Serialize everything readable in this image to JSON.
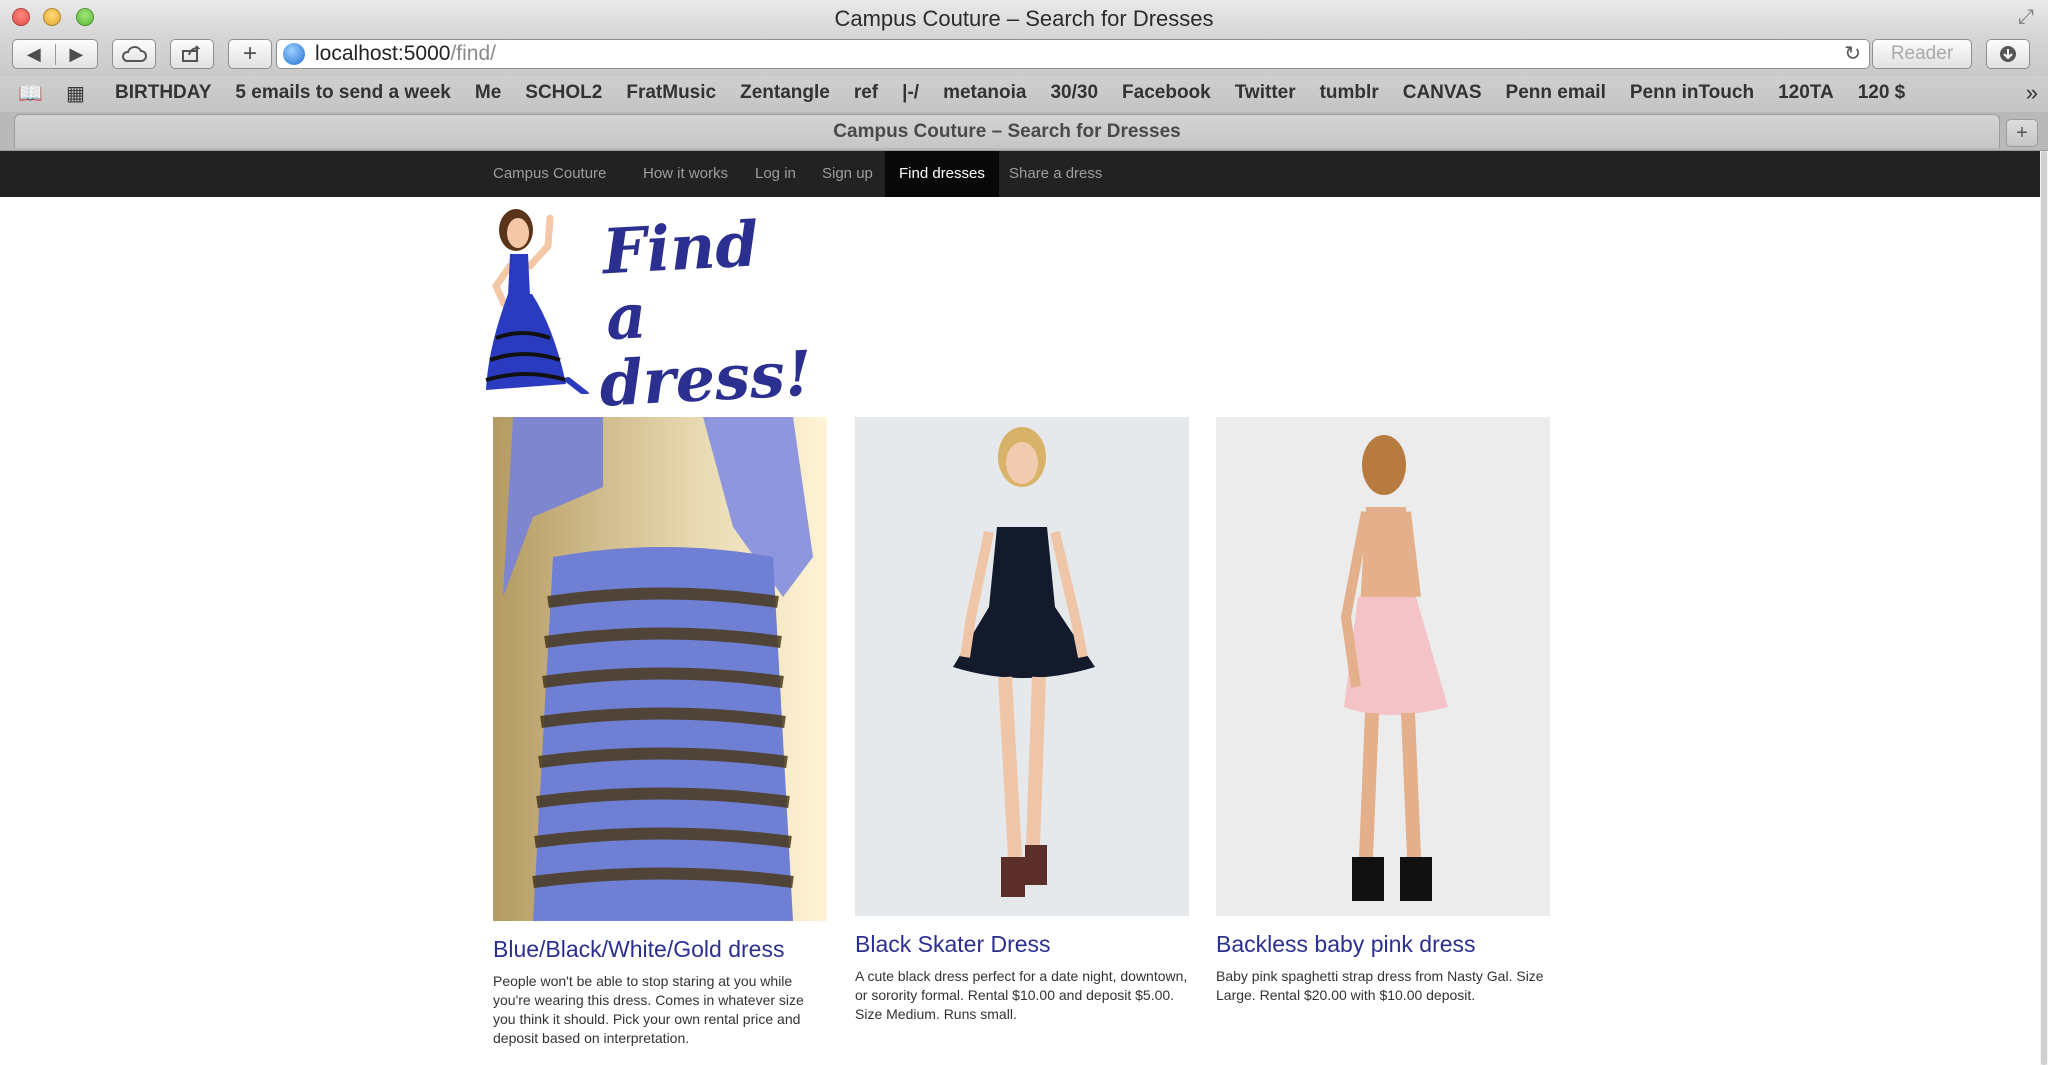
{
  "window": {
    "title": "Campus Couture – Search for Dresses"
  },
  "toolbar": {
    "back_icon": "◀",
    "forward_icon": "▶",
    "newtab_icon": "+",
    "url_host": "localhost:5000",
    "url_path": "/find/",
    "reader_label": "Reader"
  },
  "bookmarks": [
    "BIRTHDAY",
    "5 emails to send a week",
    "Me",
    "SCHOL2",
    "FratMusic",
    "Zentangle",
    "ref",
    "|-/",
    "metanoia",
    "30/30",
    "Facebook",
    "Twitter",
    "tumblr",
    "CANVAS",
    "Penn email",
    "Penn inTouch",
    "120TA",
    "120 $"
  ],
  "tab": {
    "title": "Campus Couture – Search for Dresses"
  },
  "site_nav": {
    "brand": "Campus Couture",
    "items": [
      "How it works",
      "Log in",
      "Sign up",
      "Find dresses",
      "Share a dress"
    ],
    "active": "Find dresses"
  },
  "hero": {
    "line1": "Find a",
    "line2": "dress!"
  },
  "dresses": [
    {
      "title": "Blue/Black/White/Gold dress",
      "description": "People won't be able to stop staring at you while you're wearing this dress. Comes in whatever size you think it should. Pick your own rental price and deposit based on interpretation."
    },
    {
      "title": "Black Skater Dress",
      "description": "A cute black dress perfect for a date night, downtown, or sorority formal. Rental $10.00 and deposit $5.00. Size Medium. Runs small."
    },
    {
      "title": "Backless baby pink dress",
      "description": "Baby pink spaghetti strap dress from Nasty Gal. Size Large. Rental $20.00 with $10.00 deposit."
    }
  ],
  "colors": {
    "accent": "#2b2f8f",
    "nav_bg": "#222222",
    "nav_active_bg": "#080808"
  }
}
